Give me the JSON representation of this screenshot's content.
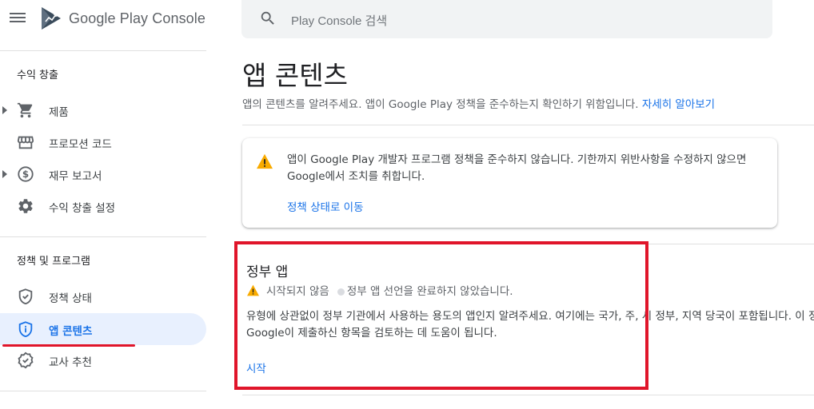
{
  "app": {
    "title": "Google Play Console"
  },
  "search": {
    "placeholder": "Play Console 검색"
  },
  "sidebar": {
    "sections": [
      {
        "heading": "수익 창출",
        "items": [
          {
            "label": "제품",
            "icon": "cart-icon",
            "expandable": true
          },
          {
            "label": "프로모션 코드",
            "icon": "store-icon",
            "expandable": false
          },
          {
            "label": "재무 보고서",
            "icon": "dollar-icon",
            "expandable": true
          },
          {
            "label": "수익 창출 설정",
            "icon": "gear-icon",
            "expandable": false
          }
        ]
      },
      {
        "heading": "정책 및 프로그램",
        "items": [
          {
            "label": "정책 상태",
            "icon": "shield-check-icon",
            "expandable": false
          },
          {
            "label": "앱 콘텐츠",
            "icon": "shield-info-icon",
            "expandable": false,
            "active": true
          },
          {
            "label": "교사 추천",
            "icon": "badge-icon",
            "expandable": false
          }
        ]
      }
    ]
  },
  "main": {
    "title": "앱 콘텐츠",
    "subtitle": "앱의 콘텐츠를 알려주세요. 앱이 Google Play 정책을 준수하는지 확인하기 위함입니다.",
    "subtitle_link": "자세히 알아보기",
    "alert": {
      "text": "앱이 Google Play 개발자 프로그램 정책을 준수하지 않습니다. 기한까지 위반사항을 수정하지 않으면 Google에서 조치를 취합니다.",
      "link": "정책 상태로 이동"
    },
    "government_app": {
      "title": "정부 앱",
      "status": "시작되지 않음",
      "status_detail": "정부 앱 선언을 완료하지 않았습니다.",
      "description": "유형에 상관없이 정부 기관에서 사용하는 용도의 앱인지 알려주세요. 여기에는 국가, 주, 시 정부, 지역 당국이 포함됩니다. 이 정보는 Google이 제출하신 항목을 검토하는 데 도움이 됩니다.",
      "action": "시작"
    }
  },
  "colors": {
    "accent": "#1a73e8",
    "warning": "#f9ab00",
    "highlight": "#e0152a",
    "active_bg": "#e8f0fe"
  }
}
